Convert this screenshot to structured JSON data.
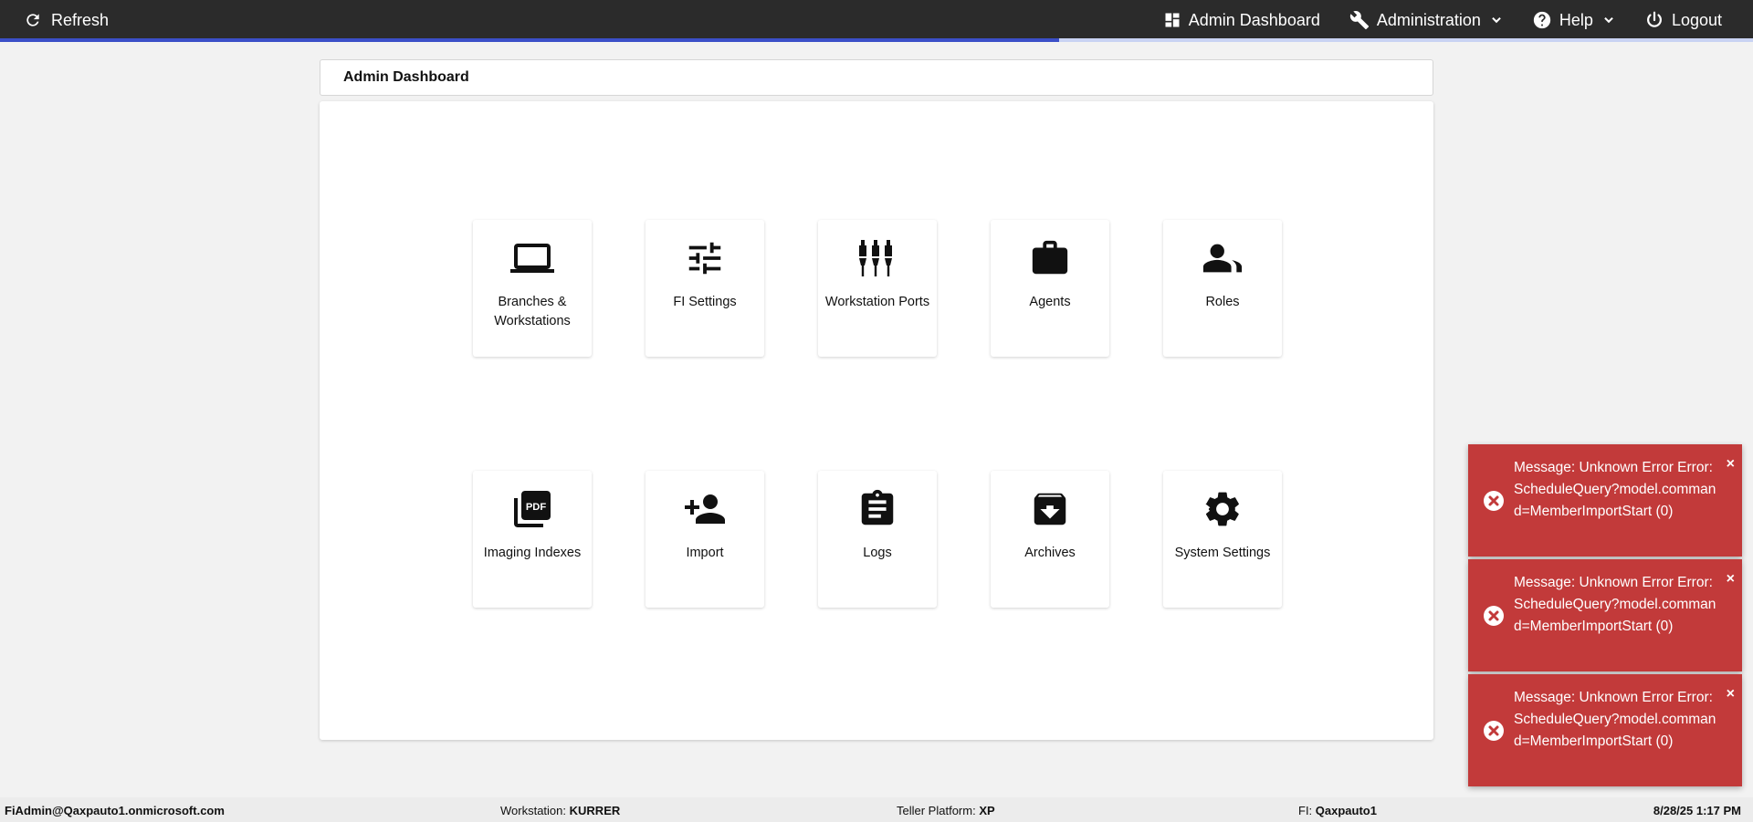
{
  "topbar": {
    "refresh_label": "Refresh",
    "nav": {
      "dashboard": "Admin Dashboard",
      "administration": "Administration",
      "help": "Help",
      "logout": "Logout"
    }
  },
  "breadcrumb": {
    "title": "Admin Dashboard"
  },
  "tiles": [
    {
      "label": "Branches & Workstations",
      "icon": "laptop-icon"
    },
    {
      "label": "FI Settings",
      "icon": "sliders-icon"
    },
    {
      "label": "Workstation Ports",
      "icon": "ports-icon"
    },
    {
      "label": "Agents",
      "icon": "briefcase-icon"
    },
    {
      "label": "Roles",
      "icon": "people-icon"
    },
    {
      "label": "Imaging Indexes",
      "icon": "pdf-icon"
    },
    {
      "label": "Import",
      "icon": "person-add-icon"
    },
    {
      "label": "Logs",
      "icon": "clipboard-icon"
    },
    {
      "label": "Archives",
      "icon": "archive-icon"
    },
    {
      "label": "System Settings",
      "icon": "gear-icon"
    }
  ],
  "toasts": [
    {
      "message": "Message: Unknown Error Error: ScheduleQuery?model.command=MemberImportStart (0)",
      "close": "×"
    },
    {
      "message": "Message: Unknown Error Error: ScheduleQuery?model.command=MemberImportStart (0)",
      "close": "×"
    },
    {
      "message": "Message: Unknown Error Error: ScheduleQuery?model.command=MemberImportStart (0)",
      "close": "×"
    }
  ],
  "status": {
    "user": "FiAdmin@Qaxpauto1.onmicrosoft.com",
    "workstation_label": "Workstation:",
    "workstation_value": "KURRER",
    "platform_label": "Teller Platform:",
    "platform_value": "XP",
    "fi_label": "FI:",
    "fi_value": "Qaxpauto1",
    "datetime": "8/28/25 1:17 PM"
  },
  "colors": {
    "topbar": "#2b2b2b",
    "progress": "#3b4fc8",
    "toast": "#c23a3a"
  }
}
